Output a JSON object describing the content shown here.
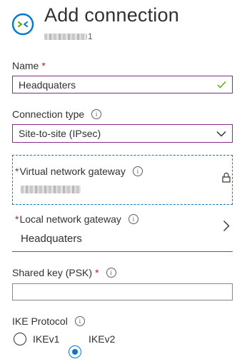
{
  "header": {
    "title": "Add connection",
    "subtitle_suffix": "1"
  },
  "name": {
    "label": "Name",
    "required_mark": "*",
    "value": "Headquaters",
    "valid_icon": "check-icon"
  },
  "connection_type": {
    "label": "Connection type",
    "selected": "Site-to-site (IPsec)"
  },
  "virtual_network_gateway": {
    "required_mark": "*",
    "label": "Virtual network gateway",
    "lock_icon": "lock-icon"
  },
  "local_network_gateway": {
    "required_mark": "*",
    "label": "Local network gateway",
    "value": "Headquaters"
  },
  "shared_key": {
    "label": "Shared key (PSK)",
    "required_mark": "*",
    "value": ""
  },
  "ike_protocol": {
    "label": "IKE Protocol",
    "options": [
      "IKEv1",
      "IKEv2"
    ],
    "selected": "IKEv2"
  },
  "colors": {
    "accent": "#0078d4",
    "focus_border": "#8a2a8f",
    "required": "#a4262c",
    "valid": "#57a300"
  }
}
